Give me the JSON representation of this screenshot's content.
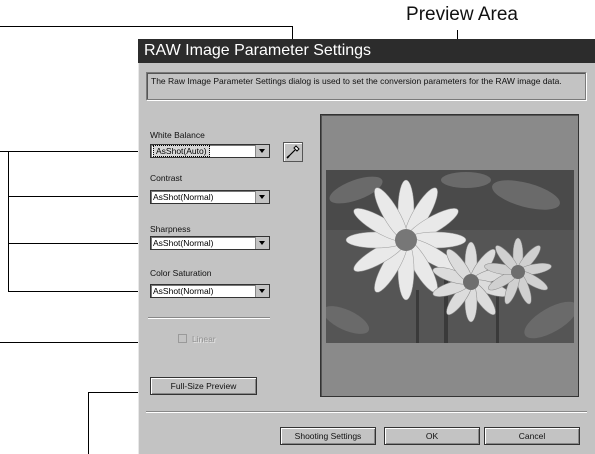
{
  "callouts": {
    "preview_area": "Preview Area"
  },
  "dialog": {
    "title": "RAW Image Parameter Settings",
    "description": "The Raw Image Parameter Settings dialog is used to set the conversion parameters for the RAW image data.",
    "white_balance": {
      "label": "White Balance",
      "value": "AsShot(Auto)"
    },
    "contrast": {
      "label": "Contrast",
      "value": "AsShot(Normal)"
    },
    "sharpness": {
      "label": "Sharpness",
      "value": "AsShot(Normal)"
    },
    "color_saturation": {
      "label": "Color Saturation",
      "value": "AsShot(Normal)"
    },
    "linear": {
      "label": "Linear",
      "checked": false,
      "enabled": false
    },
    "eyedropper_icon": "eyedropper-icon",
    "buttons": {
      "full_size_preview": "Full-Size Preview",
      "shooting_settings": "Shooting Settings",
      "ok": "OK",
      "cancel": "Cancel"
    }
  }
}
